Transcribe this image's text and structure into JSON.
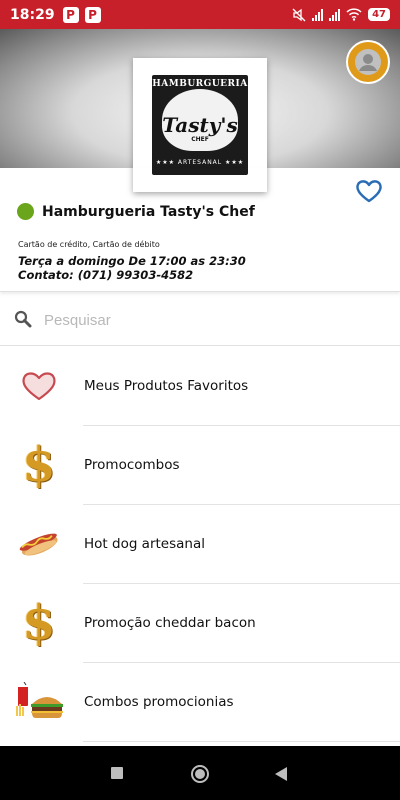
{
  "status_bar": {
    "time": "18:29",
    "app_icons": [
      "P",
      "P"
    ],
    "battery": "47"
  },
  "logo": {
    "top_text": "HAMBURGUERIA",
    "name_text": "Tasty's",
    "sub_text": "CHEF",
    "band_text": "★★★ ARTESANAL ★★★"
  },
  "store": {
    "name": "Hamburgueria Tasty's Chef",
    "status_color": "#6aa51c",
    "payment_methods": "Cartão de crédito, Cartão de débito",
    "hours": "Terça a domingo De 17:00 as 23:30",
    "contact": "Contato: (071) 99303-4582"
  },
  "search": {
    "placeholder": "Pesquisar"
  },
  "categories": [
    {
      "label": "Meus Produtos Favoritos",
      "icon": "heart-icon"
    },
    {
      "label": "Promocombos",
      "icon": "dollar-icon"
    },
    {
      "label": "Hot dog artesanal",
      "icon": "hotdog-icon"
    },
    {
      "label": "Promoção cheddar bacon",
      "icon": "dollar-icon"
    },
    {
      "label": "Combos promocionias",
      "icon": "combo-icon"
    }
  ],
  "colors": {
    "status_bar": "#c8202a",
    "accent_blue": "#2a6db5",
    "avatar": "#e09a1a"
  }
}
